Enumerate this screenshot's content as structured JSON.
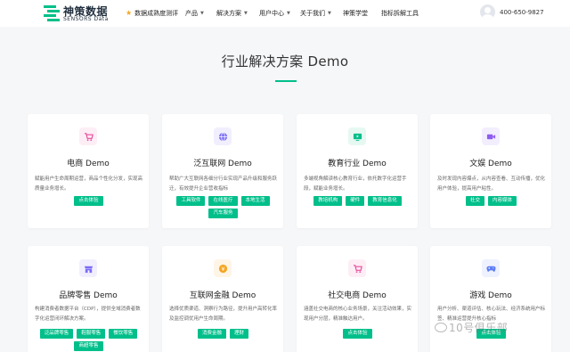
{
  "header": {
    "logo_cn": "神策数据",
    "logo_en": "SENSORS Data",
    "nav": [
      {
        "label": "数据成熟度测评",
        "has_star": true,
        "has_caret": false
      },
      {
        "label": "产品",
        "has_caret": true
      },
      {
        "label": "解决方案",
        "has_caret": true
      },
      {
        "label": "用户中心",
        "has_caret": true
      },
      {
        "label": "关于我们",
        "has_caret": true
      },
      {
        "label": "神策学堂",
        "has_caret": false
      },
      {
        "label": "指标拆解工具",
        "has_caret": false
      }
    ],
    "phone": "400-650-9827"
  },
  "page": {
    "title": "行业解决方案 Demo"
  },
  "cards": [
    {
      "title": "电商 Demo",
      "desc": "赋能用户生命周期运营，商品个性化分发，实现高质量业务增长。",
      "tags": [
        "点击体验"
      ],
      "icon": "cart-icon",
      "icon_color": "#e84d9b",
      "icon_bg": "#fdeef6"
    },
    {
      "title": "泛互联网 Demo",
      "desc": "帮助广大互联网各细分行业实现产品升级和服务跃迁，有效提升企业营收指标",
      "tags": [
        "工具软件",
        "在线医疗",
        "本地生活",
        "汽车服务"
      ],
      "icon": "globe-icon",
      "icon_color": "#7b6cf6",
      "icon_bg": "#f1effe"
    },
    {
      "title": "教育行业 Demo",
      "desc": "多端视角解读核心教育行业，依托数字化运营手段，赋能业务增长。",
      "tags": [
        "教培机构",
        "硬件",
        "教育信息化"
      ],
      "icon": "screen-icon",
      "icon_color": "#00bf8a",
      "icon_bg": "#e6f8f2"
    },
    {
      "title": "文娱 Demo",
      "desc": "及时发现内容爆点，从内容查看、互动传播，优化用户体验，提高用户粘性。",
      "tags": [
        "社交",
        "内容媒体"
      ],
      "icon": "video-icon",
      "icon_color": "#8e5cf0",
      "icon_bg": "#f3eefe"
    },
    {
      "title": "品牌零售 Demo",
      "desc": "构建消费者数据平台（CDP），提供全域消费者数字化运营闭环解决方案。",
      "tags": [
        "泛品牌零售",
        "鞋服零售",
        "餐饮零售",
        "商超零售"
      ],
      "icon": "store-icon",
      "icon_color": "#7b6cf6",
      "icon_bg": "#f1effe"
    },
    {
      "title": "互联网金融 Demo",
      "desc": "选择优质渠道、洞察行为路径，提升用户高转化率及监控调优用户生命周期。",
      "tags": [
        "消费金融",
        "理财"
      ],
      "icon": "coin-icon",
      "icon_color": "#f5a623",
      "icon_bg": "#fef5e6"
    },
    {
      "title": "社交电商 Demo",
      "desc": "涵盖社交电商的核心业务场景，关注活动效果，实现用户分层，精准触达用户。",
      "tags": [
        "点击体验"
      ],
      "icon": "cart-icon",
      "icon_color": "#e84d9b",
      "icon_bg": "#fdeef6"
    },
    {
      "title": "游戏 Demo",
      "desc": "用户分析、渠道评估、核心玩法、经济系统用户标签、精准运营提升核心指标",
      "tags": [
        "点击体验"
      ],
      "icon": "gamepad-icon",
      "icon_color": "#5b7cf6",
      "icon_bg": "#eef1fe"
    }
  ],
  "watermark": "10号俱乐部"
}
